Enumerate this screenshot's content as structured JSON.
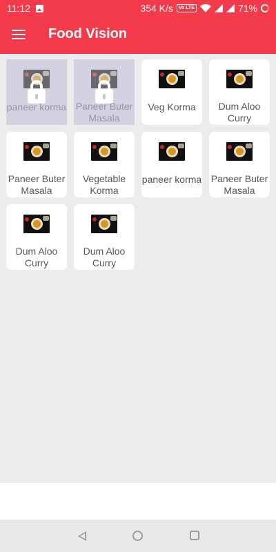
{
  "status_bar": {
    "time": "11:12",
    "network_speed": "354 K/s",
    "volte": "Vo LTE",
    "battery": "71%"
  },
  "app_bar": {
    "title": "Food Vision",
    "menu_icon": "hamburger-menu-icon"
  },
  "foods": [
    {
      "name": "paneer korma",
      "locked": true
    },
    {
      "name": "Paneer Buter Masala",
      "locked": true
    },
    {
      "name": "Veg Korma",
      "locked": false
    },
    {
      "name": "Dum Aloo Curry",
      "locked": false
    },
    {
      "name": "Paneer Buter Masala",
      "locked": false
    },
    {
      "name": "Vegetable Korma",
      "locked": false
    },
    {
      "name": "paneer korma",
      "locked": false
    },
    {
      "name": "Paneer Buter Masala",
      "locked": false
    },
    {
      "name": "Dum Aloo Curry",
      "locked": false
    },
    {
      "name": "Dum Aloo Curry",
      "locked": false
    }
  ],
  "nav_bar": {
    "back_icon": "back-triangle-icon",
    "home_icon": "home-circle-icon",
    "recents_icon": "recents-square-icon"
  },
  "colors": {
    "primary": "#f23a4b",
    "background": "#ececec",
    "locked_overlay": "#d3d2e0"
  }
}
